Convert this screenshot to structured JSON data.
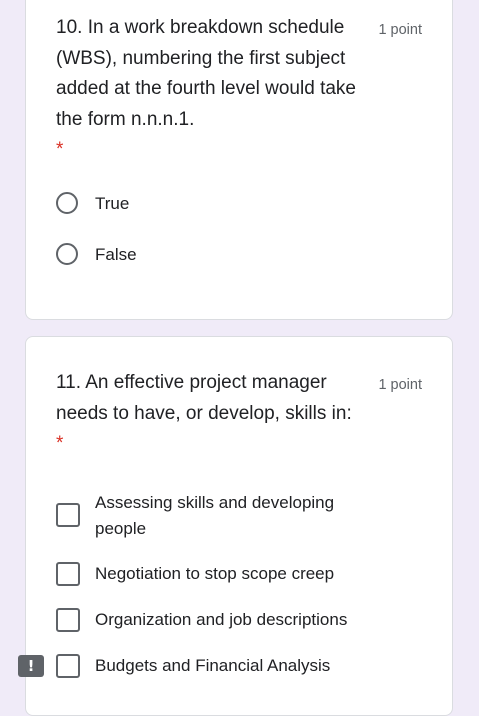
{
  "questions": [
    {
      "title": "10. In a work breakdown schedule (WBS), numbering the first subject added at the fourth level would take the form n.n.n.1.",
      "required_mark": "*",
      "points": "1 point",
      "type": "radio",
      "options": [
        "True",
        "False"
      ]
    },
    {
      "title": "11. An effective project manager needs to have, or develop, skills in:",
      "required_mark": "*",
      "points": "1 point",
      "type": "checkbox",
      "options": [
        "Assessing skills and developing people",
        "Negotiation to stop scope creep",
        "Organization and job descriptions",
        "Budgets and Financial Analysis"
      ]
    }
  ],
  "report_button": {
    "label": "!"
  },
  "colors": {
    "background": "#f0ebf8",
    "required": "#d93025",
    "points_text": "#5f6368"
  }
}
